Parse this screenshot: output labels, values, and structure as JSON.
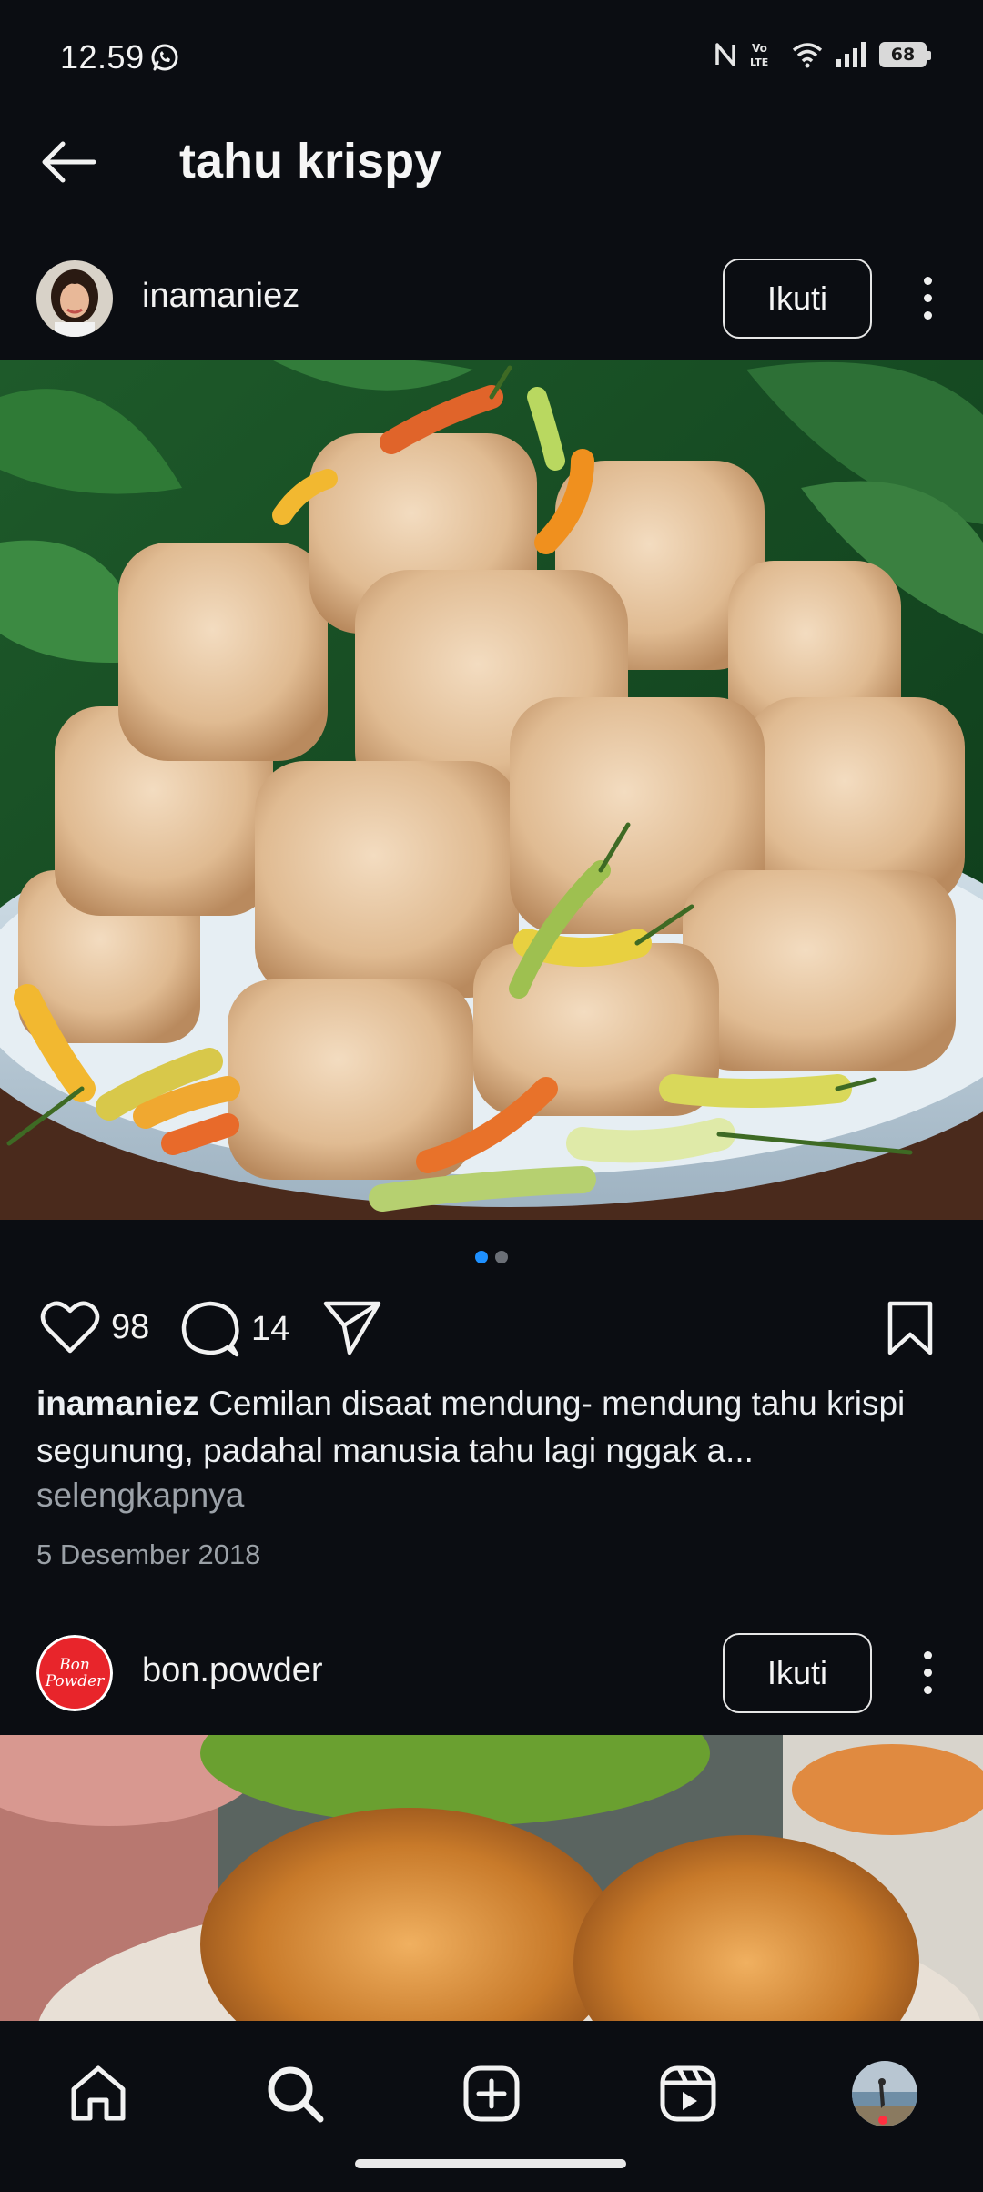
{
  "status_bar": {
    "time": "12.59",
    "battery": "68",
    "icons": [
      "whatsapp-icon",
      "nfc-icon",
      "volte-icon",
      "wifi-icon",
      "signal-icon",
      "battery-icon"
    ]
  },
  "header": {
    "title": "tahu krispy",
    "back_icon": "arrow-left-icon"
  },
  "posts": [
    {
      "username": "inamaniez",
      "follow_label": "Ikuti",
      "image_description_icon": "tofu-photo",
      "carousel_count": 2,
      "carousel_active": 1,
      "likes": "98",
      "comments": "14",
      "caption_user": "inamaniez",
      "caption_text": "Cemilan disaat mendung- mendung tahu krispi segunung, padahal manusia tahu lagi nggak a...",
      "more_label": "selengkapnya",
      "date": "5 Desember 2018"
    },
    {
      "username": "bon.powder",
      "follow_label": "Ikuti",
      "logo_text_line1": "Bon",
      "logo_text_line2": "Powder"
    }
  ],
  "bottom_nav": {
    "items": [
      "home-icon",
      "search-icon",
      "create-icon",
      "reels-icon",
      "profile-avatar"
    ]
  },
  "colors": {
    "background": "#0b0d12",
    "accent": "#1e90ff",
    "notification": "#ff3040",
    "bon_logo": "#e8252b"
  }
}
